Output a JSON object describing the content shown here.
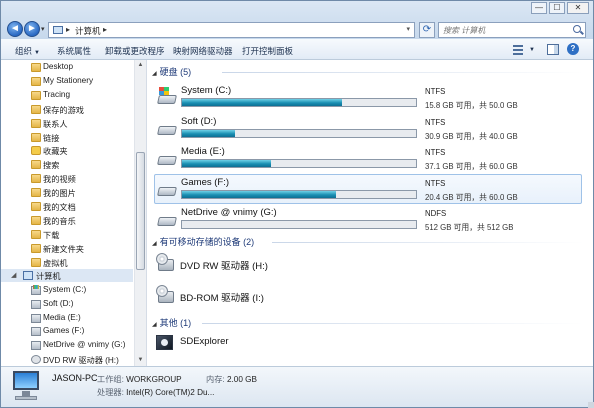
{
  "window": {
    "address_crumb": "计算机",
    "search_placeholder": "搜索 计算机",
    "nav": {
      "back_glyph": "◄",
      "forward_glyph": "►"
    },
    "controls": {
      "minimize": "—",
      "maximize": "☐",
      "close": "✕"
    }
  },
  "toolbar": {
    "organize": "组织",
    "system_properties": "系统属性",
    "uninstall": "卸载或更改程序",
    "map_drive": "映射网络驱动器",
    "control_panel": "打开控制面板"
  },
  "sidebar": {
    "items": [
      {
        "label": "Desktop",
        "icon": "folder-icon"
      },
      {
        "label": "My Stationery",
        "icon": "folder-icon"
      },
      {
        "label": "Tracing",
        "icon": "folder-icon"
      },
      {
        "label": "保存的游戏",
        "icon": "folder-icon"
      },
      {
        "label": "联系人",
        "icon": "folder-icon"
      },
      {
        "label": "链接",
        "icon": "folder-icon"
      },
      {
        "label": "收藏夹",
        "icon": "star-icon"
      },
      {
        "label": "搜索",
        "icon": "folder-icon"
      },
      {
        "label": "我的视频",
        "icon": "folder-icon"
      },
      {
        "label": "我的图片",
        "icon": "folder-icon"
      },
      {
        "label": "我的文档",
        "icon": "folder-icon"
      },
      {
        "label": "我的音乐",
        "icon": "folder-icon"
      },
      {
        "label": "下载",
        "icon": "folder-icon"
      },
      {
        "label": "新建文件夹",
        "icon": "folder-icon"
      },
      {
        "label": "虚拟机",
        "icon": "folder-icon"
      }
    ],
    "computer": "计算机",
    "drives": [
      {
        "label": "System (C:)",
        "icon": "system-drive-icon"
      },
      {
        "label": "Soft (D:)",
        "icon": "drive-icon"
      },
      {
        "label": "Media (E:)",
        "icon": "drive-icon"
      },
      {
        "label": "Games (F:)",
        "icon": "drive-icon"
      },
      {
        "label": "NetDrive @ vnimy (G:)",
        "icon": "drive-icon"
      },
      {
        "label": "DVD RW 驱动器 (H:)",
        "icon": "dvd-icon"
      }
    ]
  },
  "content": {
    "hard_disks_header": "硬盘 (5)",
    "removable_header": "有可移动存储的设备 (2)",
    "other_header": "其他 (1)",
    "drives": [
      {
        "name": "System (C:)",
        "fs": "NTFS",
        "space": "15.8 GB 可用，共 50.0 GB",
        "used_fraction": 0.684,
        "selected": false
      },
      {
        "name": "Soft (D:)",
        "fs": "NTFS",
        "space": "30.9 GB 可用，共 40.0 GB",
        "used_fraction": 0.2275,
        "selected": false
      },
      {
        "name": "Media (E:)",
        "fs": "NTFS",
        "space": "37.1 GB 可用，共 60.0 GB",
        "used_fraction": 0.3817,
        "selected": false
      },
      {
        "name": "Games (F:)",
        "fs": "NTFS",
        "space": "20.4 GB 可用，共 60.0 GB",
        "used_fraction": 0.66,
        "selected": true
      },
      {
        "name": "NetDrive @ vnimy (G:)",
        "fs": "NDFS",
        "space": "512 GB 可用，共 512 GB",
        "used_fraction": 0.0,
        "selected": false
      }
    ],
    "removable": [
      {
        "name": "DVD RW 驱动器 (H:)"
      },
      {
        "name": "BD-ROM 驱动器 (I:)"
      }
    ],
    "other": [
      {
        "name": "SDExplorer"
      }
    ]
  },
  "details": {
    "pc_name": "JASON-PC",
    "workgroup_label": "工作组:",
    "workgroup": "WORKGROUP",
    "memory_label": "内存:",
    "memory": "2.00 GB",
    "processor_label": "处理器:",
    "processor": "Intel(R) Core(TM)2 Du..."
  }
}
